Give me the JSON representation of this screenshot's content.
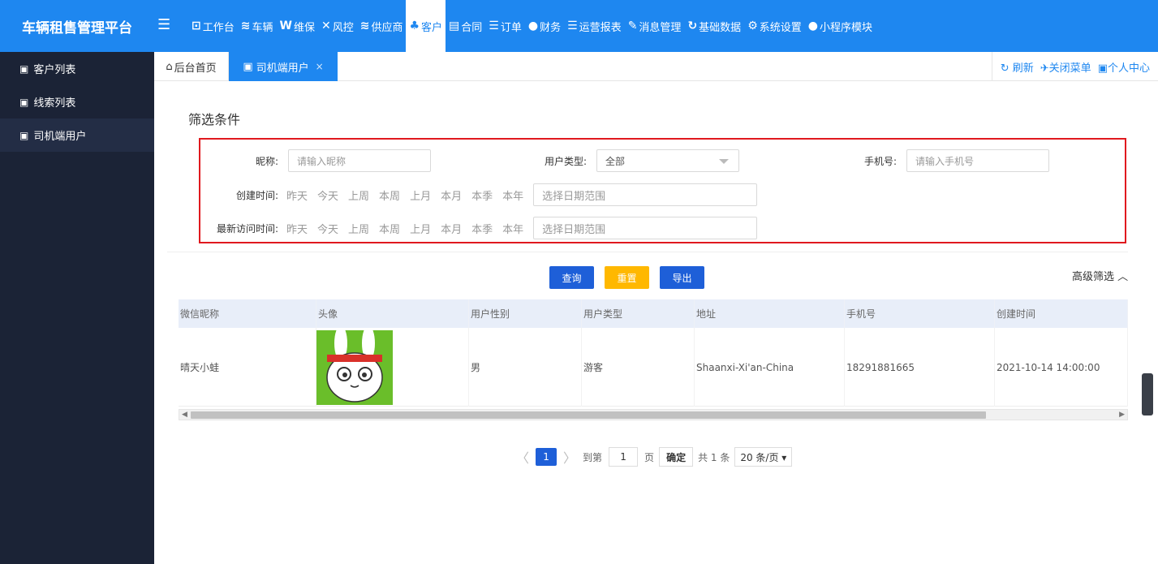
{
  "app": {
    "title": "车辆租售管理平台",
    "menu_toggle_icon": "menu-fold-icon"
  },
  "topnav": [
    {
      "icon": "workbench-icon",
      "glyph": "⊡",
      "label": "工作台"
    },
    {
      "icon": "layers-icon",
      "glyph": "≋",
      "label": "车辆"
    },
    {
      "icon": "word-doc-icon",
      "glyph": "W",
      "label": "维保"
    },
    {
      "icon": "tools-icon",
      "glyph": "✕",
      "label": "风控"
    },
    {
      "icon": "stack-icon",
      "glyph": "≋",
      "label": "供应商"
    },
    {
      "icon": "user-group-icon",
      "glyph": "♣",
      "label": "客户",
      "active": true
    },
    {
      "icon": "document-icon",
      "glyph": "▤",
      "label": "合同"
    },
    {
      "icon": "list-icon",
      "glyph": "☰",
      "label": "订单"
    },
    {
      "icon": "yen-icon",
      "glyph": "●",
      "label": "财务"
    },
    {
      "icon": "list-bullets-icon",
      "glyph": "☰",
      "label": "运营报表"
    },
    {
      "icon": "edit-icon",
      "glyph": "✎",
      "label": "消息管理"
    },
    {
      "icon": "refresh-icon",
      "glyph": "↻",
      "label": "基础数据"
    },
    {
      "icon": "settings-icon",
      "glyph": "⚙",
      "label": "系统设置"
    },
    {
      "icon": "wechat-icon",
      "glyph": "●",
      "label": "小程序模块"
    }
  ],
  "sidebar": {
    "items": [
      {
        "label": "客户列表",
        "active": false
      },
      {
        "label": "线索列表",
        "active": false
      },
      {
        "label": "司机端用户",
        "active": true
      }
    ]
  },
  "tabs": {
    "home": "后台首页",
    "active": "司机端用户",
    "close": "×",
    "refresh": "刷新",
    "close_menu": "关闭菜单",
    "profile": "个人中心"
  },
  "filter": {
    "title": "筛选条件",
    "nickname_label": "昵称:",
    "nickname_placeholder": "请输入昵称",
    "user_type_label": "用户类型:",
    "user_type_value": "全部",
    "phone_label": "手机号:",
    "phone_placeholder": "请输入手机号",
    "created_label": "创建时间:",
    "visited_label": "最新访问时间:",
    "quick_ranges": [
      "昨天",
      "今天",
      "上周",
      "本周",
      "上月",
      "本月",
      "本季",
      "本年"
    ],
    "date_placeholder": "选择日期范围"
  },
  "actions": {
    "query": "查询",
    "reset": "重置",
    "export": "导出",
    "advanced": "高级筛选 ︿"
  },
  "table": {
    "columns": [
      "微信昵称",
      "头像",
      "用户性别",
      "用户类型",
      "地址",
      "手机号",
      "创建时间"
    ],
    "rows": [
      {
        "nickname": "晴天小蛙",
        "avatar": "rabbit-avatar",
        "gender": "男",
        "type": "游客",
        "address": "Shaanxi-Xi'an-China",
        "phone": "18291881665",
        "created": "2021-10-14 14:00:00"
      }
    ]
  },
  "pagination": {
    "prev": "〈",
    "current": "1",
    "next": "〉",
    "goto_label": "到第",
    "goto_value": "1",
    "page_label": "页",
    "confirm": "确定",
    "total": "共 1 条",
    "page_size": "20 条/页 ▾"
  }
}
